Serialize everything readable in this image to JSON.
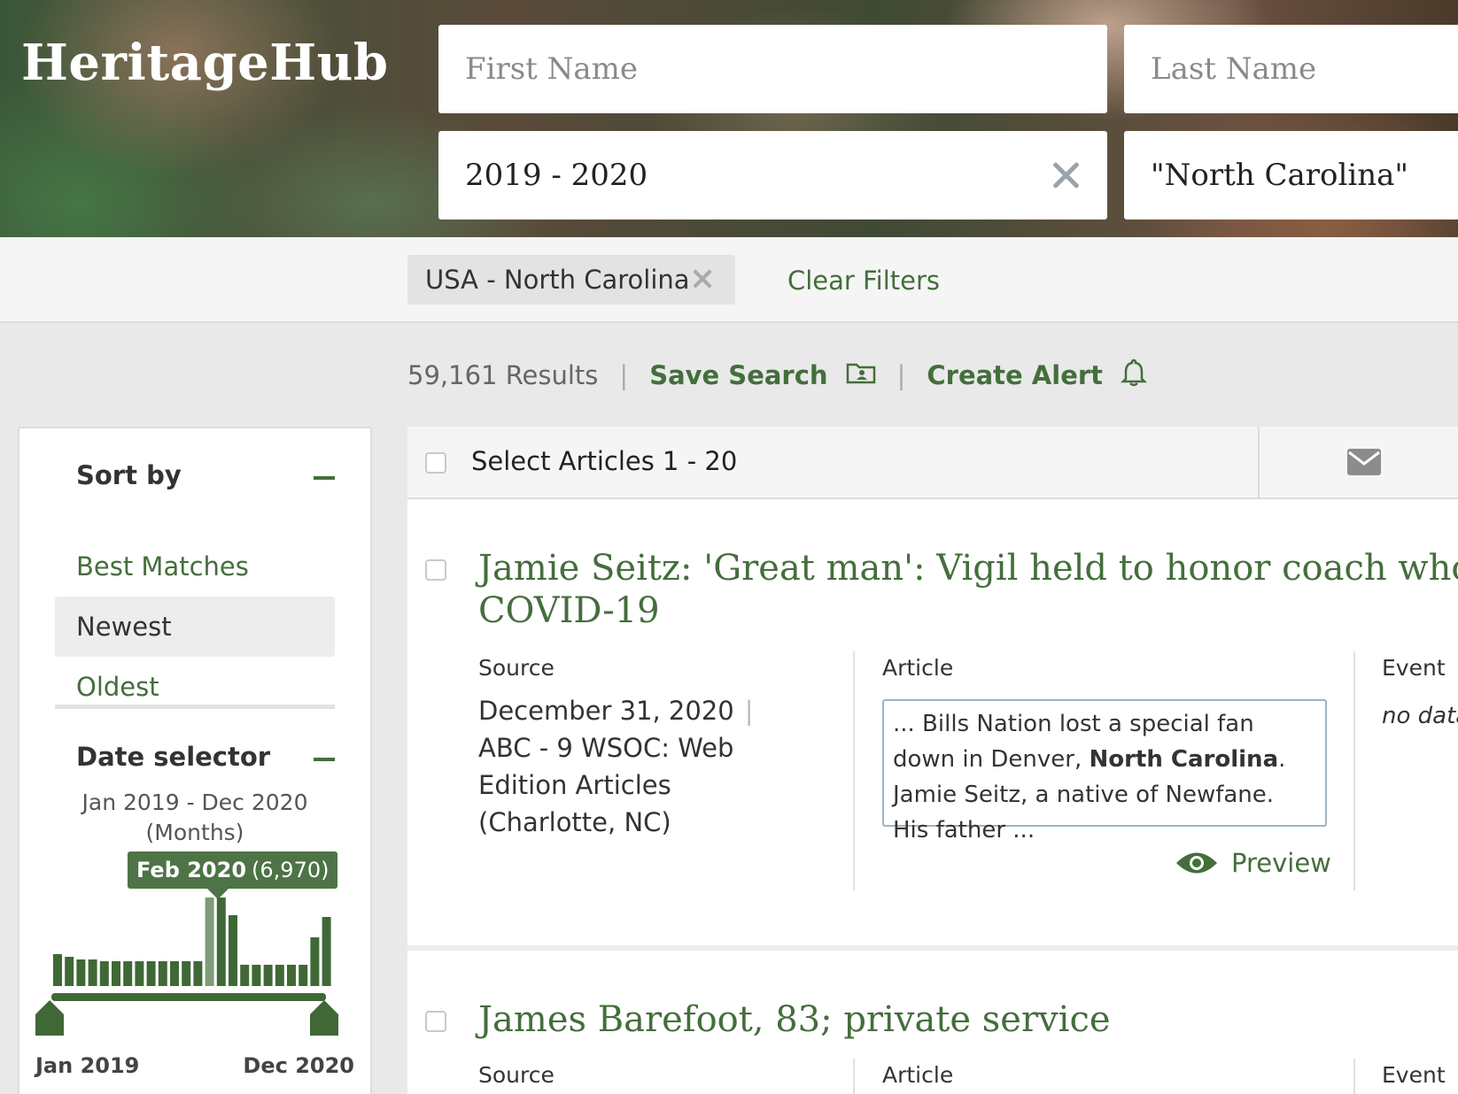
{
  "header": {
    "logo": "HeritageHub",
    "first_name_placeholder": "First Name",
    "last_name_placeholder": "Last Name",
    "date_value": "2019 - 2020",
    "keyword_value": "\"North Carolina\""
  },
  "filters": {
    "chips": [
      {
        "label": "USA - North Carolina"
      }
    ],
    "clear_label": "Clear Filters"
  },
  "results": {
    "count": "59,161 Results",
    "save_search": "Save Search",
    "create_alert": "Create Alert"
  },
  "sidebar": {
    "sort_title": "Sort by",
    "sort_options": [
      {
        "label": "Best Matches",
        "active": false
      },
      {
        "label": "Newest",
        "active": true
      },
      {
        "label": "Oldest",
        "active": false
      }
    ],
    "date_title": "Date selector",
    "date_range_line1": "Jan 2019 - Dec 2020",
    "date_range_line2": "(Months)",
    "tooltip_date": "Feb 2020",
    "tooltip_count": "(6,970)",
    "range_start": "Jan 2019",
    "range_end": "Dec 2020",
    "histogram_relative_heights": [
      0.36,
      0.33,
      0.3,
      0.3,
      0.28,
      0.28,
      0.28,
      0.28,
      0.28,
      0.28,
      0.28,
      0.28,
      0.28,
      1.0,
      1.0,
      0.8,
      0.24,
      0.24,
      0.24,
      0.24,
      0.24,
      0.24,
      0.55,
      0.78
    ],
    "histogram_highlight_index": 13
  },
  "articles": {
    "select_label": "Select Articles 1 - 20",
    "col_source": "Source",
    "col_article": "Article",
    "col_event": "Event",
    "items": [
      {
        "title_line1": "Jamie Seitz: 'Great man': Vigil held to honor coach who",
        "title_line2": "COVID-19",
        "date": "December 31, 2020",
        "source_line1": "ABC - 9 WSOC: Web",
        "source_line2": "Edition Articles",
        "source_line3": "(Charlotte, NC)",
        "snippet_pre": "... Bills Nation lost a special fan down in Denver,",
        "snippet_bold": "North Carolina",
        "snippet_post": ". Jamie Seitz, a native of Newfane. His father ...",
        "preview_label": "Preview",
        "event": "no data"
      },
      {
        "title_line1": "James Barefoot, 83; private service"
      }
    ]
  },
  "colors": {
    "accent_green": "#446e3c",
    "histogram_green": "#3f6836",
    "histogram_highlight": "#7f9b7a"
  }
}
